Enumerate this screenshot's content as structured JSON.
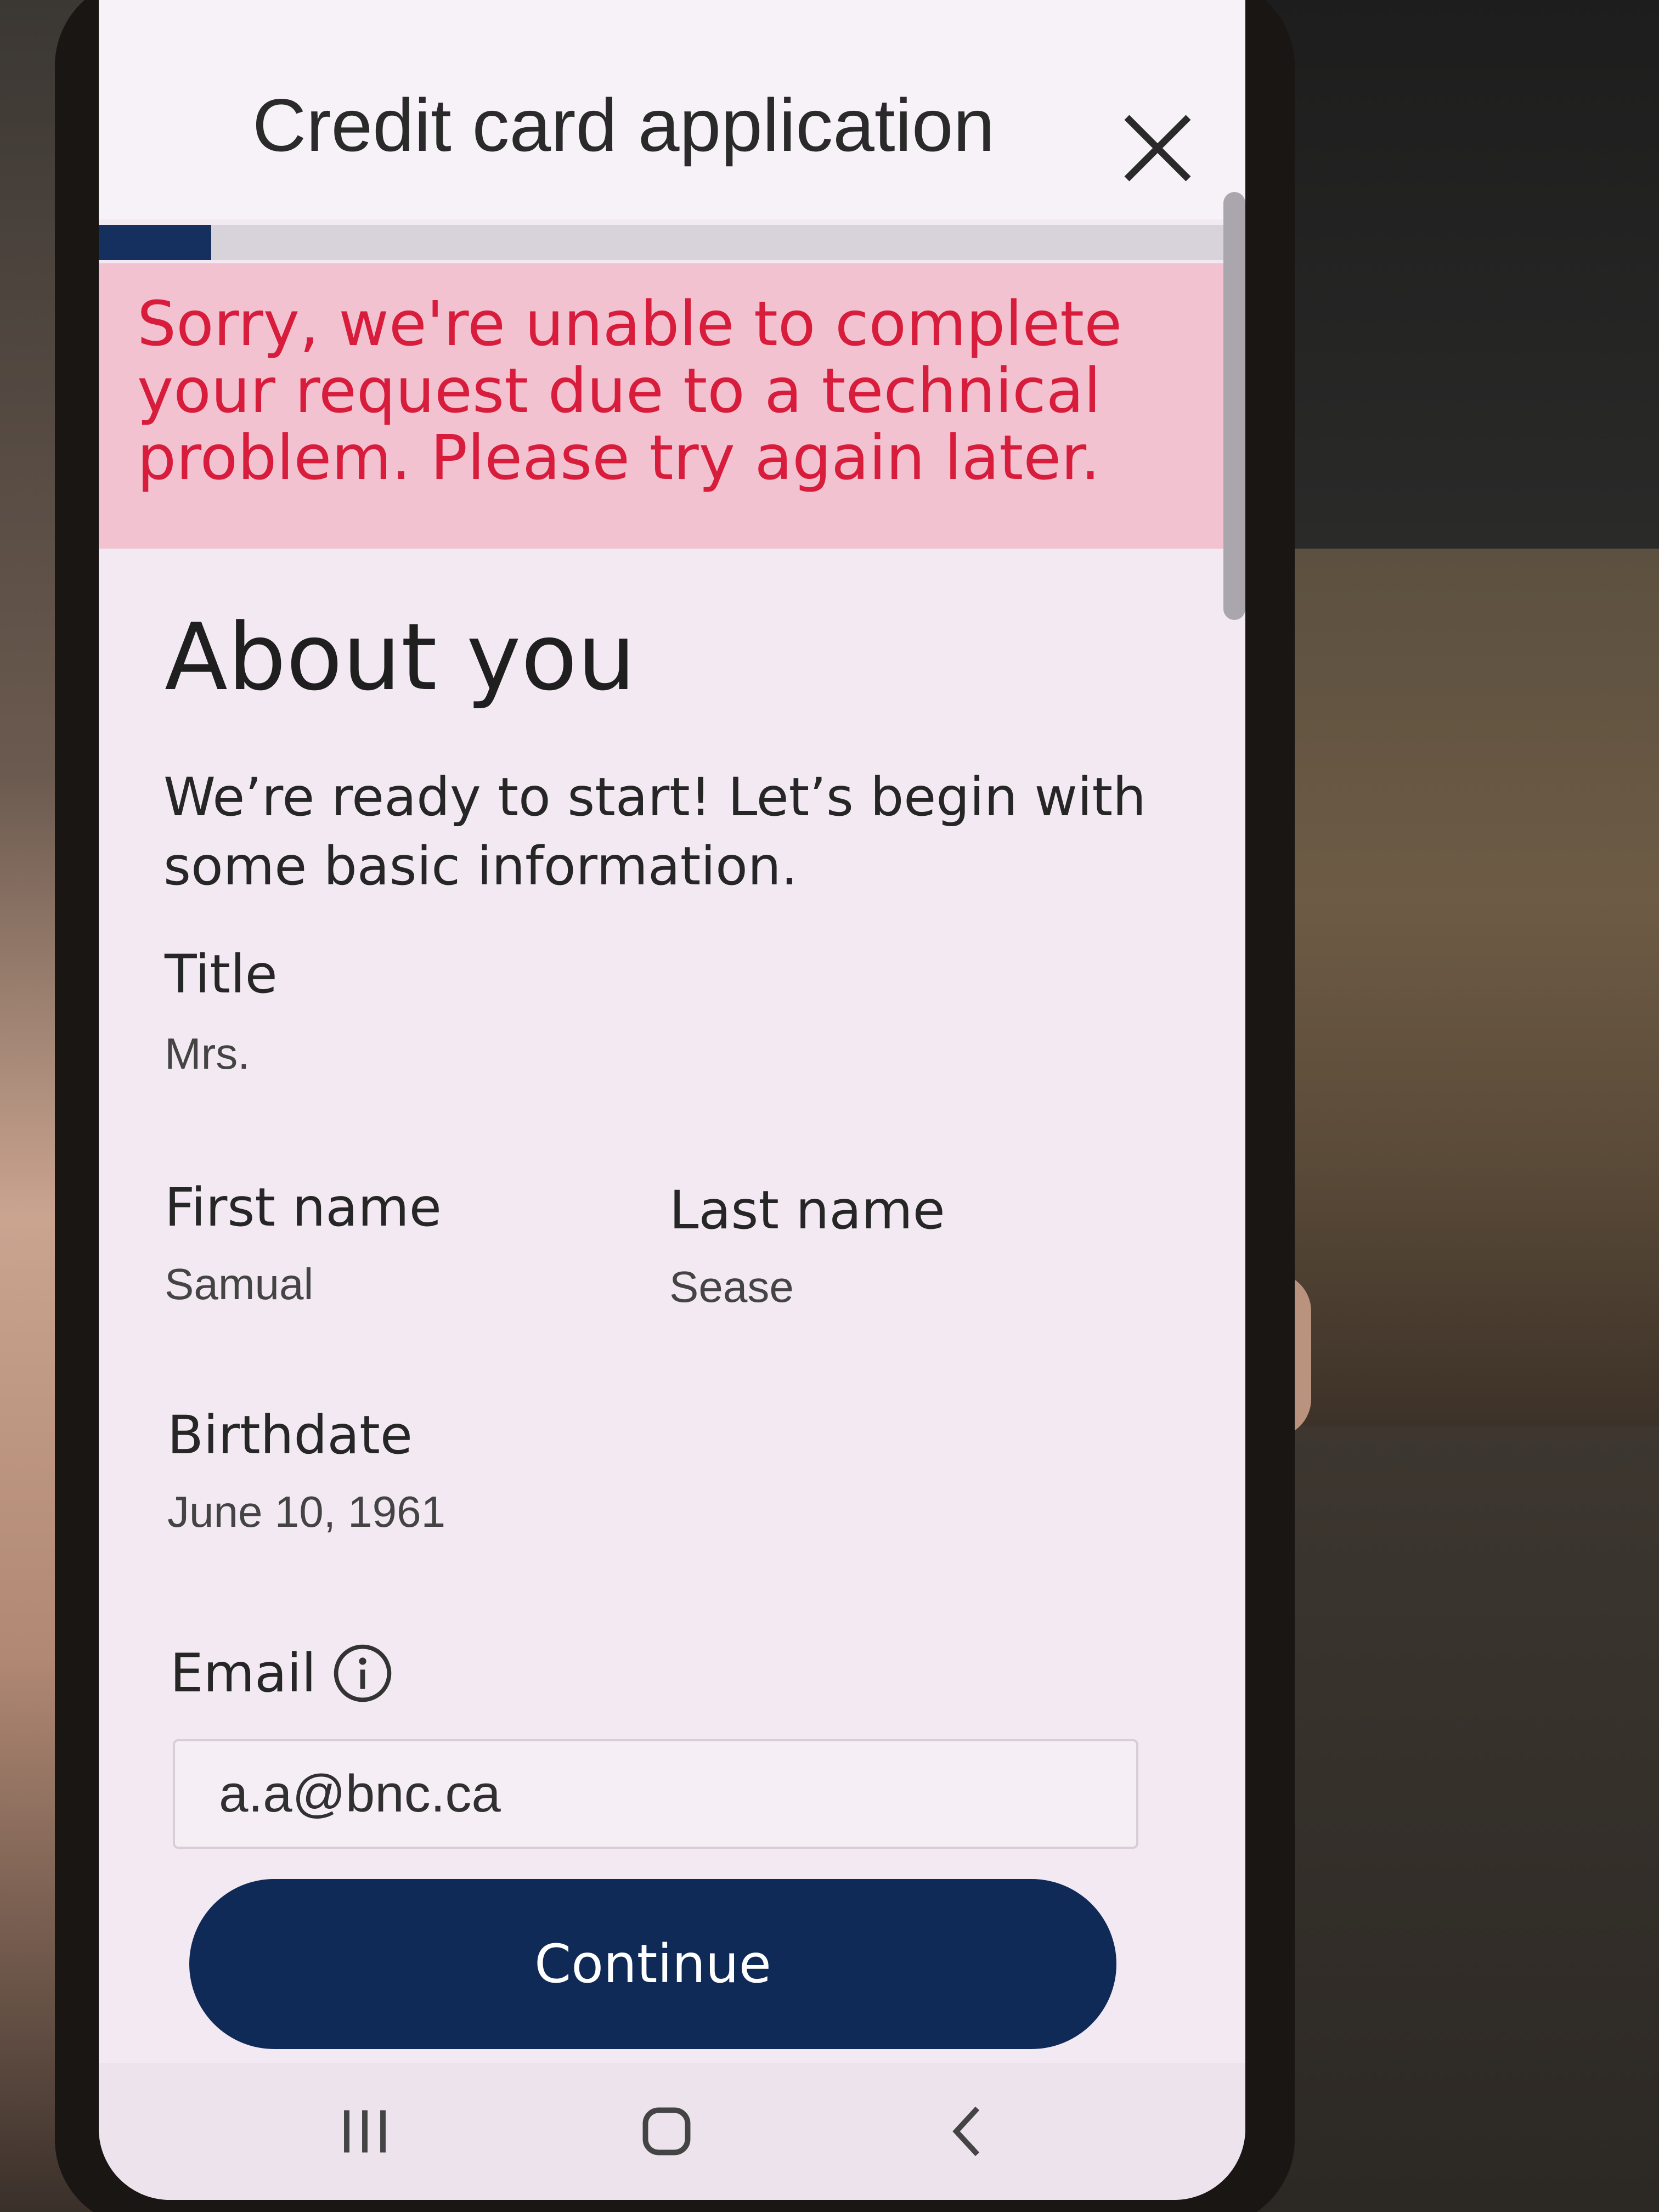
{
  "header": {
    "title": "Credit card application",
    "close_icon": "close-icon",
    "progress_fraction": 0.1
  },
  "error_banner": {
    "message": "Sorry, we're unable to complete your request due to a technical problem. Please try again later.",
    "color": "#d81c3b",
    "background": "#f2c2d1"
  },
  "main": {
    "title": "About you",
    "intro": "We’re ready to start! Let’s begin with some basic information.",
    "fields": {
      "title": {
        "label": "Title",
        "value": "Mrs."
      },
      "first_name": {
        "label": "First name",
        "value": "Samual"
      },
      "last_name": {
        "label": "Last name",
        "value": "Sease"
      },
      "birthdate": {
        "label": "Birthdate",
        "value": "June 10, 1961"
      },
      "email": {
        "label": "Email",
        "value": "a.a@bnc.ca",
        "info_icon": "info-icon"
      }
    },
    "continue_label": "Continue",
    "accent_color": "#0f2a57"
  },
  "nav_bar": {
    "icons": [
      "recent-apps-icon",
      "home-icon",
      "back-icon"
    ]
  }
}
